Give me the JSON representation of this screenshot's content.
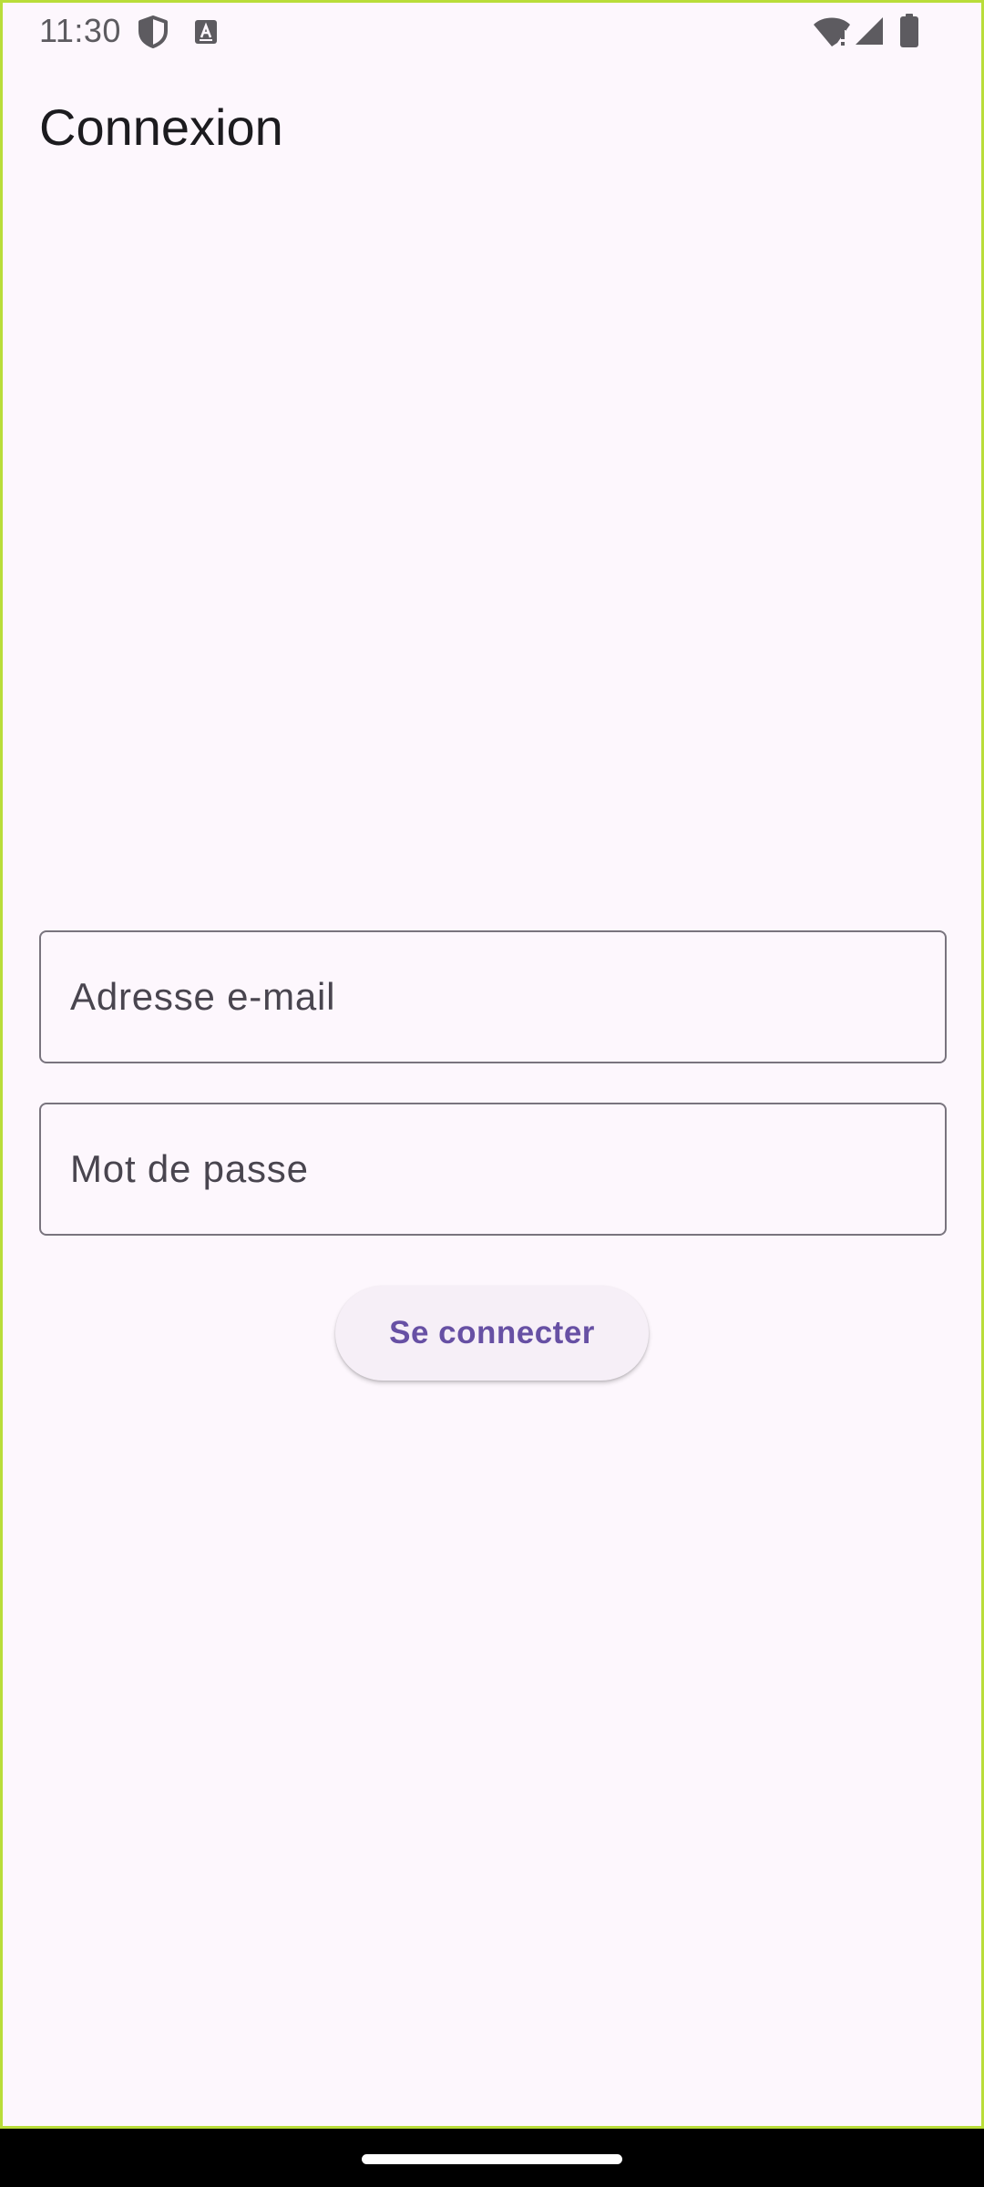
{
  "status_bar": {
    "time": "11:30",
    "icons": [
      "shield-icon",
      "text-recognition-icon",
      "wifi-alert-icon",
      "cellular-signal-icon",
      "battery-icon"
    ]
  },
  "app_bar": {
    "title": "Connexion"
  },
  "form": {
    "email_placeholder": "Adresse e-mail",
    "email_value": "",
    "password_placeholder": "Mot de passe",
    "password_value": "",
    "submit_label": "Se connecter"
  },
  "colors": {
    "background": "#fdf7fd",
    "accent": "#6750a4",
    "field_border": "#79747e",
    "button_background": "#f6eff7",
    "frame_border": "#b9dd3a"
  }
}
